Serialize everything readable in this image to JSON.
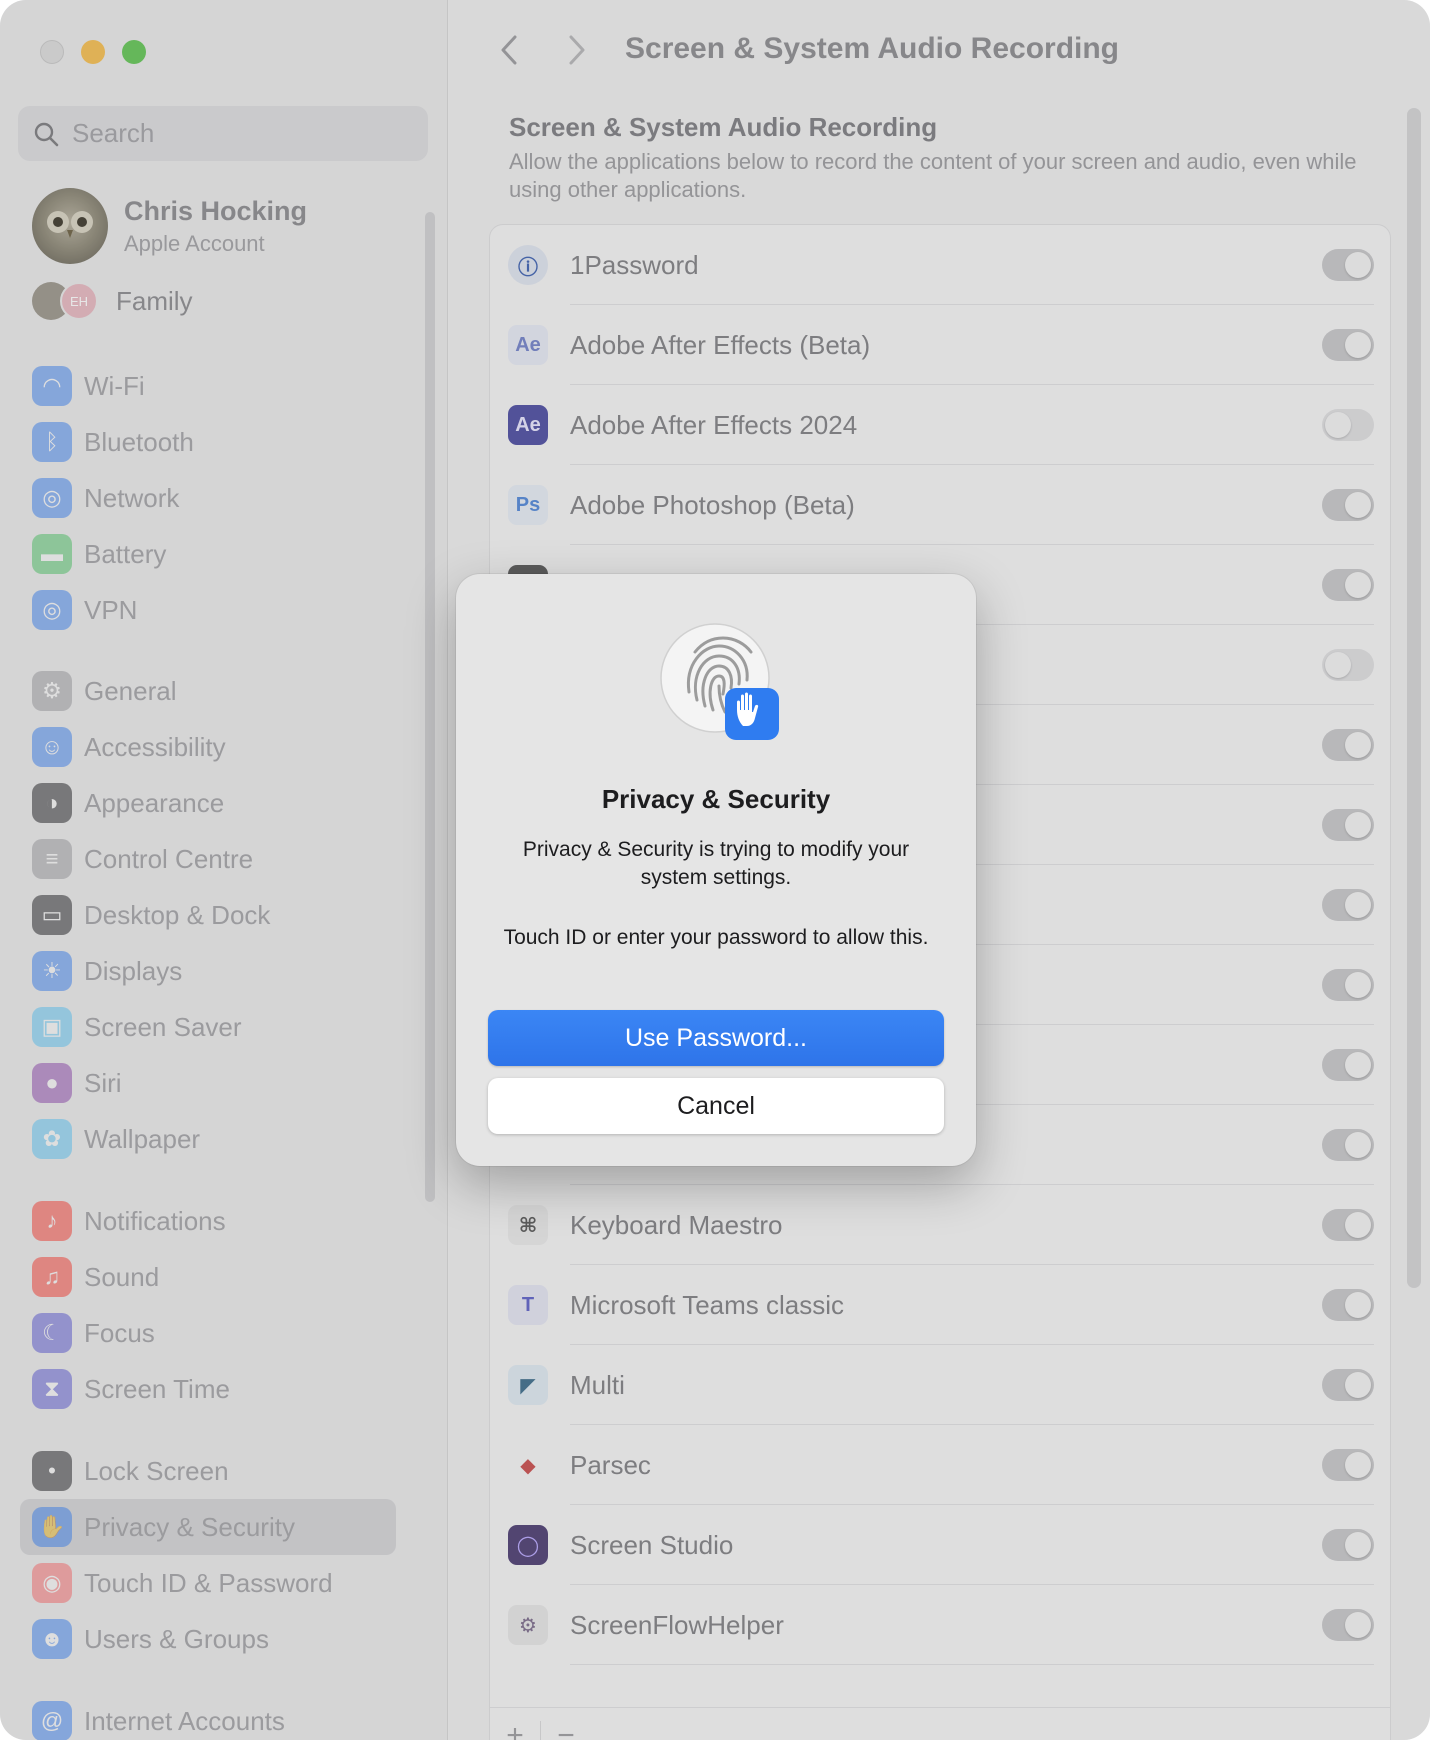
{
  "sidebar": {
    "search_placeholder": "Search",
    "account": {
      "name": "Chris Hocking",
      "subtitle": "Apple Account"
    },
    "family": {
      "label": "Family",
      "avatar_initials": "EH"
    },
    "items": [
      {
        "label": "Wi-Fi",
        "icon": "wifi-icon",
        "color": "#3a82f6"
      },
      {
        "label": "Bluetooth",
        "icon": "bluetooth-icon",
        "color": "#3a82f6"
      },
      {
        "label": "Network",
        "icon": "globe-icon",
        "color": "#3a82f6"
      },
      {
        "label": "Battery",
        "icon": "battery-icon",
        "color": "#4cc764"
      },
      {
        "label": "VPN",
        "icon": "vpn-globe-icon",
        "color": "#3a82f6"
      },
      {
        "label": "General",
        "icon": "gear-icon",
        "color": "#9a9a9e"
      },
      {
        "label": "Accessibility",
        "icon": "accessibility-icon",
        "color": "#3a82f6"
      },
      {
        "label": "Appearance",
        "icon": "appearance-icon",
        "color": "#1d1d1f"
      },
      {
        "label": "Control Centre",
        "icon": "control-centre-icon",
        "color": "#9a9a9e"
      },
      {
        "label": "Desktop & Dock",
        "icon": "dock-icon",
        "color": "#1d1d1f"
      },
      {
        "label": "Displays",
        "icon": "sun-icon",
        "color": "#3a82f6"
      },
      {
        "label": "Screen Saver",
        "icon": "screen-saver-icon",
        "color": "#5ac8fa"
      },
      {
        "label": "Siri",
        "icon": "siri-icon",
        "color": "#8e44ad"
      },
      {
        "label": "Wallpaper",
        "icon": "flower-icon",
        "color": "#5ac8fa"
      },
      {
        "label": "Notifications",
        "icon": "bell-icon",
        "color": "#ff3b30"
      },
      {
        "label": "Sound",
        "icon": "speaker-icon",
        "color": "#ff3b30"
      },
      {
        "label": "Focus",
        "icon": "moon-icon",
        "color": "#5856d6"
      },
      {
        "label": "Screen Time",
        "icon": "hourglass-icon",
        "color": "#5856d6"
      },
      {
        "label": "Lock Screen",
        "icon": "lock-icon",
        "color": "#1d1d1f"
      },
      {
        "label": "Privacy & Security",
        "icon": "hand-icon",
        "color": "#3a82f6"
      },
      {
        "label": "Touch ID & Password",
        "icon": "fingerprint-icon",
        "color": "#ff6b6b"
      },
      {
        "label": "Users & Groups",
        "icon": "users-icon",
        "color": "#3a82f6"
      },
      {
        "label": "Internet Accounts",
        "icon": "at-icon",
        "color": "#3a82f6"
      }
    ]
  },
  "main": {
    "title": "Screen & System Audio Recording",
    "section_title": "Screen & System Audio Recording",
    "section_description": "Allow the applications below to record the content of your screen and audio, even while using other applications.",
    "apps": [
      {
        "name": "1Password",
        "icon_text": "ⓘ",
        "enabled": true
      },
      {
        "name": "Adobe After Effects (Beta)",
        "icon_text": "Ae",
        "enabled": true
      },
      {
        "name": "Adobe After Effects 2024",
        "icon_text": "Ae",
        "enabled": false
      },
      {
        "name": "Adobe Photoshop (Beta)",
        "icon_text": "Ps",
        "enabled": true
      },
      {
        "name": "",
        "icon_text": "",
        "enabled": true
      },
      {
        "name": "",
        "icon_text": "",
        "enabled": false
      },
      {
        "name": "",
        "icon_text": "",
        "enabled": true
      },
      {
        "name": "",
        "icon_text": "",
        "enabled": true
      },
      {
        "name": "",
        "icon_text": "",
        "enabled": true
      },
      {
        "name": "",
        "icon_text": "",
        "enabled": true
      },
      {
        "name": "",
        "icon_text": "",
        "enabled": true
      },
      {
        "name": "",
        "icon_text": "",
        "enabled": true
      },
      {
        "name": "Keyboard Maestro",
        "icon_text": "⌘",
        "enabled": true
      },
      {
        "name": "Microsoft Teams classic",
        "icon_text": "T",
        "enabled": true
      },
      {
        "name": "Multi",
        "icon_text": "◤",
        "enabled": true
      },
      {
        "name": "Parsec",
        "icon_text": "◆",
        "enabled": true
      },
      {
        "name": "Screen Studio",
        "icon_text": "◯",
        "enabled": true
      },
      {
        "name": "ScreenFlowHelper",
        "icon_text": "⚙",
        "enabled": true
      }
    ],
    "footer": {
      "add": "+",
      "remove": "−"
    }
  },
  "dialog": {
    "title": "Privacy & Security",
    "message": "Privacy & Security is trying to modify your system settings.",
    "message2": "Touch ID or enter your password to allow this.",
    "primary_button": "Use Password...",
    "secondary_button": "Cancel",
    "accent_color": "#2e74e9"
  }
}
